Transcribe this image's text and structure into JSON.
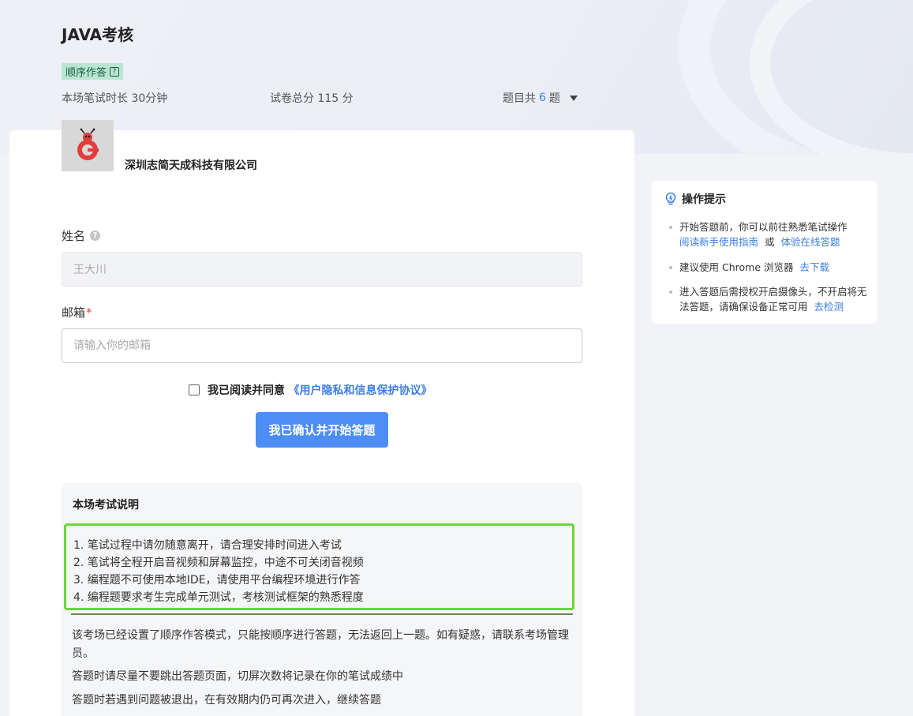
{
  "header": {
    "title": "JAVA考核",
    "mode_badge": "顺序作答",
    "duration": "本场笔试时长 30分钟",
    "score": "试卷总分 115 分",
    "count_prefix": "题目共",
    "count_num": "6",
    "count_suffix": "题"
  },
  "company": {
    "name": "深圳志简天成科技有限公司",
    "logo_icon": "bee-logo-icon"
  },
  "form": {
    "name_label": "姓名",
    "name_value": "王大川",
    "email_label": "邮箱",
    "email_required": "*",
    "email_placeholder": "请输入你的邮箱",
    "agree_text": "我已阅读并同意",
    "agree_link": "《用户隐私和信息保护协议》",
    "start_button": "我已确认并开始答题"
  },
  "notes": {
    "title": "本场考试说明",
    "rules": [
      "1. 笔试过程中请勿随意离开，请合理安排时间进入考试",
      "2. 笔试将全程开启音视频和屏幕监控，中途不可关闭音视频",
      "3. 编程题不可使用本地IDE，请使用平台编程环境进行作答",
      "4. 编程题要求考生完成单元测试，考核测试框架的熟悉程度"
    ],
    "paragraphs": [
      "该考场已经设置了顺序作答模式，只能按顺序进行答题，无法返回上一题。如有疑惑，请联系考场管理员。",
      "答题时请尽量不要跳出答题页面，切屏次数将记录在你的笔试成绩中",
      "答题时若遇到问题被退出，在有效期内仍可再次进入，继续答题"
    ]
  },
  "tips": {
    "title": "操作提示",
    "t1_text": "开始答题前，你可以前往熟悉笔试操作",
    "t1_link1": "阅读新手使用指南",
    "t1_or": "或",
    "t1_link2": "体验在线答题",
    "t2_text": "建议使用 Chrome 浏览器",
    "t2_link": "去下载",
    "t3_text": "进入答题后需授权开启摄像头，不开启将无法答题，请确保设备正常可用",
    "t3_link": "去检测"
  },
  "colors": {
    "accent": "#4c8ef5",
    "link": "#3b7de6",
    "badge_bg": "#b8e6d3",
    "highlight_border": "#6cd63a"
  }
}
